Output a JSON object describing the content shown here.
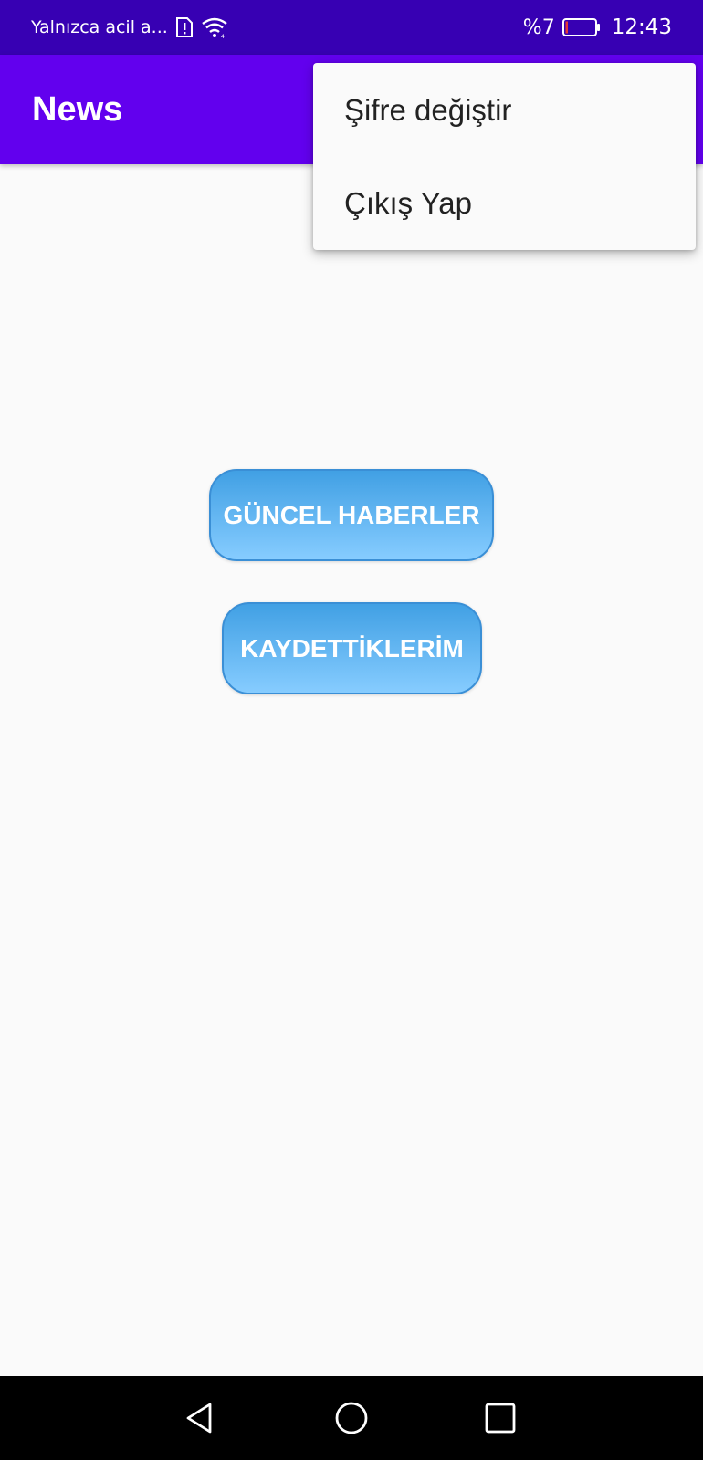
{
  "status_bar": {
    "carrier_text": "Yalnızca acil a...",
    "battery_percent": "%7",
    "battery_level": 0.07,
    "time": "12:43",
    "icons": [
      "sim-alert-icon",
      "wifi-icon",
      "battery-icon"
    ],
    "colors": {
      "background": "#3700b3",
      "battery_low": "#e53935"
    }
  },
  "app_bar": {
    "title": "News",
    "color": "#6200ee"
  },
  "overflow_menu": {
    "items": [
      {
        "label": "Şifre değiştir"
      },
      {
        "label": "Çıkış Yap"
      }
    ]
  },
  "main": {
    "buttons": [
      {
        "label": "GÜNCEL HABERLER"
      },
      {
        "label": "KAYDETTİKLERİM"
      }
    ],
    "button_colors": {
      "top": "#41a0e4",
      "bottom": "#86ccff",
      "border": "#3a8fd6"
    }
  },
  "nav_bar": {
    "icons": [
      "back-icon",
      "home-icon",
      "recents-icon"
    ]
  }
}
